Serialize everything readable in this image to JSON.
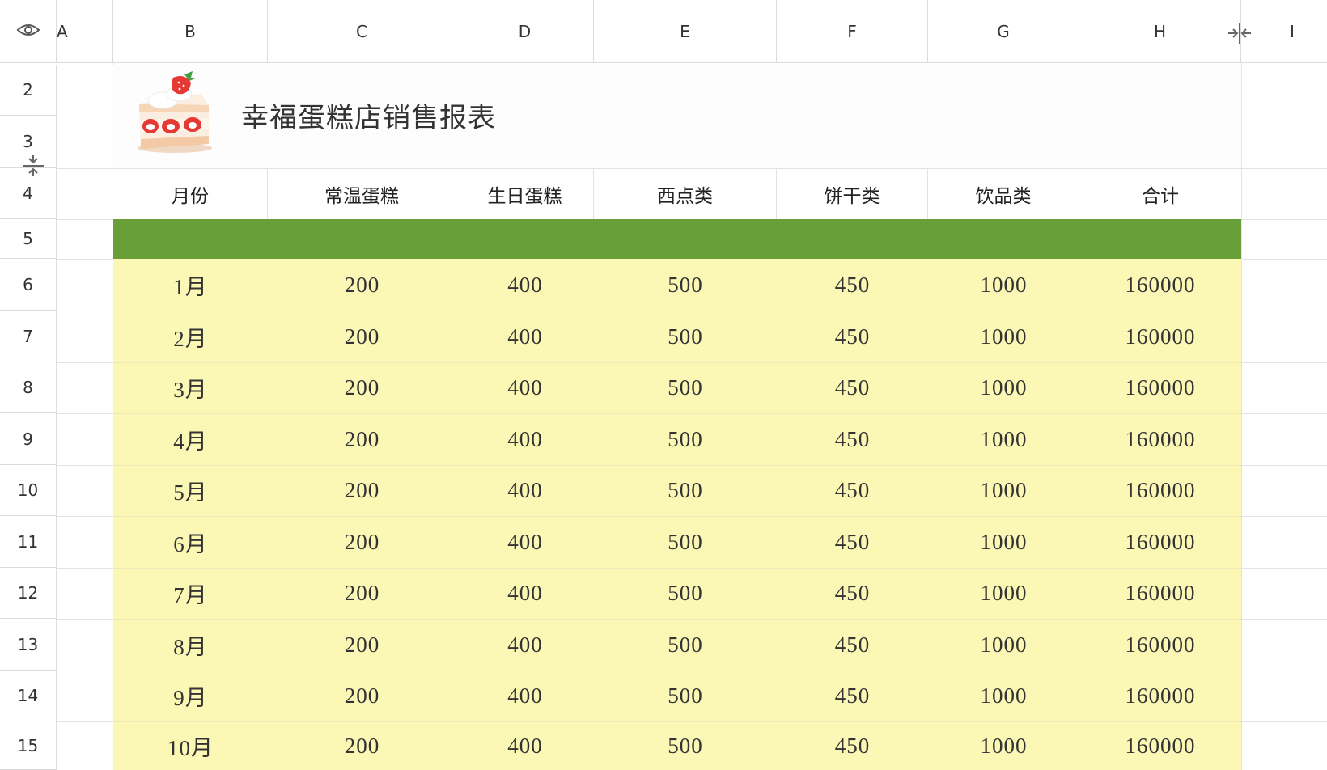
{
  "column_headers": [
    "A",
    "B",
    "C",
    "D",
    "E",
    "F",
    "G",
    "H",
    "I"
  ],
  "row_numbers": [
    "2",
    "3",
    "4",
    "5",
    "6",
    "7",
    "8",
    "9",
    "10",
    "11",
    "12",
    "13",
    "14",
    "15"
  ],
  "title": "幸福蛋糕店销售报表",
  "table": {
    "headers": [
      "月份",
      "常温蛋糕",
      "生日蛋糕",
      "西点类",
      "饼干类",
      "饮品类",
      "合计"
    ],
    "rows": [
      [
        "1月",
        "200",
        "400",
        "500",
        "450",
        "1000",
        "160000"
      ],
      [
        "2月",
        "200",
        "400",
        "500",
        "450",
        "1000",
        "160000"
      ],
      [
        "3月",
        "200",
        "400",
        "500",
        "450",
        "1000",
        "160000"
      ],
      [
        "4月",
        "200",
        "400",
        "500",
        "450",
        "1000",
        "160000"
      ],
      [
        "5月",
        "200",
        "400",
        "500",
        "450",
        "1000",
        "160000"
      ],
      [
        "6月",
        "200",
        "400",
        "500",
        "450",
        "1000",
        "160000"
      ],
      [
        "7月",
        "200",
        "400",
        "500",
        "450",
        "1000",
        "160000"
      ],
      [
        "8月",
        "200",
        "400",
        "500",
        "450",
        "1000",
        "160000"
      ],
      [
        "9月",
        "200",
        "400",
        "500",
        "450",
        "1000",
        "160000"
      ],
      [
        "10月",
        "200",
        "400",
        "500",
        "450",
        "1000",
        "160000"
      ]
    ]
  },
  "icons": {
    "visibility": "eye-icon",
    "column_resize": "column-resize-icon",
    "row_resize": "row-resize-icon",
    "title_image": "strawberry-cake-icon"
  },
  "colors": {
    "header_band": "#689f38",
    "data_fill": "#fbf8b6"
  }
}
